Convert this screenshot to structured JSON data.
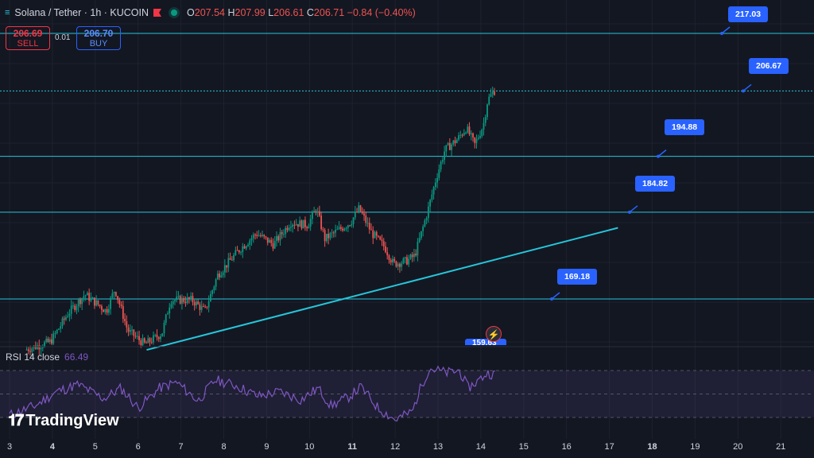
{
  "legend": {
    "symbol": "Solana / Tether · 1h · KUCOIN",
    "open_key": "O",
    "open": "207.54",
    "high_key": "H",
    "high": "207.99",
    "low_key": "L",
    "low": "206.61",
    "close_key": "C",
    "close": "206.71",
    "change": "−0.84 (−0.40%)"
  },
  "trade": {
    "sell_price": "206.69",
    "sell_label": "SELL",
    "spread": "0.01",
    "buy_price": "206.70",
    "buy_label": "BUY"
  },
  "price_levels": [
    {
      "label": "217.03",
      "price": 217.03
    },
    {
      "label": "206.67",
      "price": 206.67
    },
    {
      "label": "194.88",
      "price": 194.88
    },
    {
      "label": "184.82",
      "price": 184.82
    },
    {
      "label": "169.18",
      "price": 169.18
    }
  ],
  "hidden_level_label": "159.63",
  "rsi": {
    "label": "RSI 14 close",
    "value": "66.49",
    "bands": [
      70,
      50,
      30
    ]
  },
  "brand": {
    "name": "TradingView"
  },
  "x_axis": [
    {
      "label": "3",
      "bold": false
    },
    {
      "label": "4",
      "bold": true
    },
    {
      "label": "5",
      "bold": false
    },
    {
      "label": "6",
      "bold": false
    },
    {
      "label": "7",
      "bold": false
    },
    {
      "label": "8",
      "bold": false
    },
    {
      "label": "9",
      "bold": false
    },
    {
      "label": "10",
      "bold": false
    },
    {
      "label": "11",
      "bold": true
    },
    {
      "label": "12",
      "bold": false
    },
    {
      "label": "13",
      "bold": false
    },
    {
      "label": "14",
      "bold": false
    },
    {
      "label": "15",
      "bold": false
    },
    {
      "label": "16",
      "bold": false
    },
    {
      "label": "17",
      "bold": false
    },
    {
      "label": "18",
      "bold": true
    },
    {
      "label": "19",
      "bold": false
    },
    {
      "label": "20",
      "bold": false
    },
    {
      "label": "21",
      "bold": false
    }
  ],
  "colors": {
    "bg": "#131722",
    "up": "#089981",
    "down": "#ef5350",
    "hline": "#26c6da",
    "label": "#2962ff",
    "rsi": "#7e57c2"
  },
  "chart_data": {
    "type": "candlestick",
    "ylim": [
      158,
      220
    ],
    "price_path": [
      {
        "day": 3.4,
        "price": 160.0
      },
      {
        "day": 4.0,
        "price": 161.5
      },
      {
        "day": 4.4,
        "price": 166.5
      },
      {
        "day": 4.8,
        "price": 170.0
      },
      {
        "day": 5.3,
        "price": 167.0
      },
      {
        "day": 5.5,
        "price": 171.0
      },
      {
        "day": 5.8,
        "price": 163.5
      },
      {
        "day": 6.2,
        "price": 161.0
      },
      {
        "day": 6.6,
        "price": 163.0
      },
      {
        "day": 6.8,
        "price": 169.0
      },
      {
        "day": 7.3,
        "price": 169.0
      },
      {
        "day": 7.6,
        "price": 167.0
      },
      {
        "day": 7.9,
        "price": 173.5
      },
      {
        "day": 8.4,
        "price": 178.0
      },
      {
        "day": 8.8,
        "price": 181.0
      },
      {
        "day": 9.2,
        "price": 179.0
      },
      {
        "day": 9.6,
        "price": 183.0
      },
      {
        "day": 10.0,
        "price": 182.5
      },
      {
        "day": 10.2,
        "price": 185.5
      },
      {
        "day": 10.4,
        "price": 180.0
      },
      {
        "day": 10.7,
        "price": 181.5
      },
      {
        "day": 11.0,
        "price": 183.0
      },
      {
        "day": 11.2,
        "price": 185.5
      },
      {
        "day": 11.5,
        "price": 181.0
      },
      {
        "day": 11.8,
        "price": 178.5
      },
      {
        "day": 12.0,
        "price": 175.5
      },
      {
        "day": 12.3,
        "price": 176.0
      },
      {
        "day": 12.5,
        "price": 177.0
      },
      {
        "day": 12.8,
        "price": 185.0
      },
      {
        "day": 13.0,
        "price": 191.0
      },
      {
        "day": 13.2,
        "price": 196.0
      },
      {
        "day": 13.5,
        "price": 198.0
      },
      {
        "day": 13.7,
        "price": 200.0
      },
      {
        "day": 13.9,
        "price": 197.0
      },
      {
        "day": 14.1,
        "price": 200.5
      },
      {
        "day": 14.2,
        "price": 205.0
      },
      {
        "day": 14.35,
        "price": 206.7
      }
    ],
    "trendline": [
      {
        "day": 6.2,
        "price": 160.0
      },
      {
        "day": 17.2,
        "price": 182.0
      }
    ],
    "rsi_path": [
      {
        "day": 3.0,
        "value": 32
      },
      {
        "day": 3.6,
        "value": 40
      },
      {
        "day": 4.1,
        "value": 52
      },
      {
        "day": 4.6,
        "value": 58
      },
      {
        "day": 5.2,
        "value": 46
      },
      {
        "day": 5.6,
        "value": 55
      },
      {
        "day": 6.0,
        "value": 38
      },
      {
        "day": 6.5,
        "value": 55
      },
      {
        "day": 6.9,
        "value": 60
      },
      {
        "day": 7.4,
        "value": 44
      },
      {
        "day": 7.8,
        "value": 62
      },
      {
        "day": 8.3,
        "value": 57
      },
      {
        "day": 8.8,
        "value": 48
      },
      {
        "day": 9.3,
        "value": 52
      },
      {
        "day": 9.8,
        "value": 45
      },
      {
        "day": 10.2,
        "value": 55
      },
      {
        "day": 10.5,
        "value": 40
      },
      {
        "day": 10.9,
        "value": 47
      },
      {
        "day": 11.2,
        "value": 56
      },
      {
        "day": 11.6,
        "value": 38
      },
      {
        "day": 12.0,
        "value": 28
      },
      {
        "day": 12.4,
        "value": 35
      },
      {
        "day": 12.6,
        "value": 56
      },
      {
        "day": 12.8,
        "value": 72
      },
      {
        "day": 13.2,
        "value": 68
      },
      {
        "day": 13.5,
        "value": 70
      },
      {
        "day": 13.7,
        "value": 55
      },
      {
        "day": 14.0,
        "value": 63
      },
      {
        "day": 14.15,
        "value": 68
      },
      {
        "day": 14.35,
        "value": 66.49
      }
    ]
  }
}
